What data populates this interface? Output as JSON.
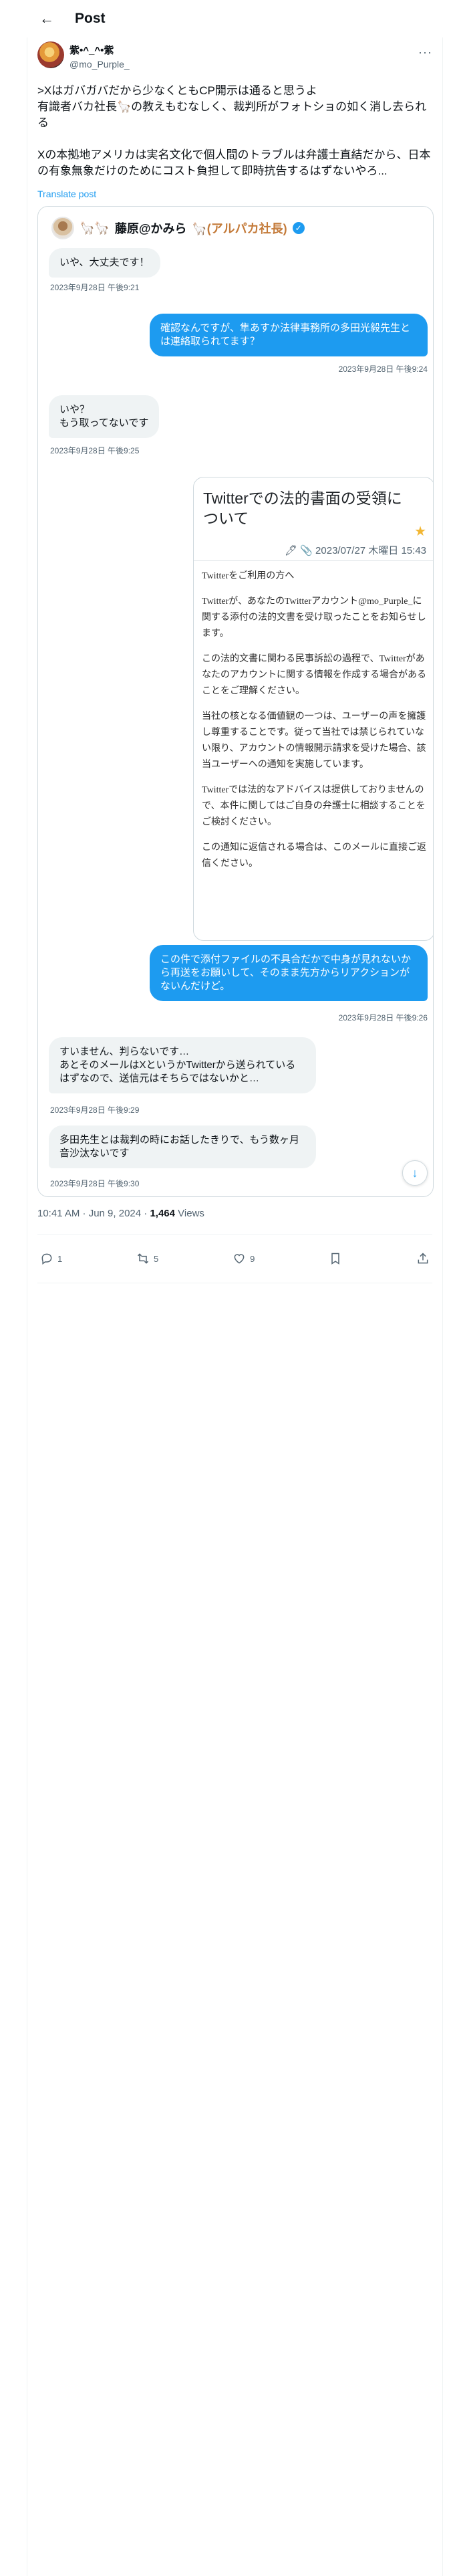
{
  "header": {
    "title": "Post"
  },
  "author": {
    "display_name": "紫•^_^•紫",
    "handle": "@mo_Purple_"
  },
  "tweet": {
    "text": ">Xはガバガバだから少なくともCP開示は通ると思うよ\n有識者バカ社長🦙の教えもむなしく、裁判所がフォトショの如く消し去られる\n\nXの本拠地アメリカは実名文化で個人間のトラブルは弁護士直結だから、日本の有象無象だけのためにコスト負担して即時抗告するはずないやろ...",
    "translate_label": "Translate post"
  },
  "screenshot": {
    "name_prefix": "🦙🦙",
    "name": "藤原@かみら",
    "name_suffix": "🦙(アルパカ社長)",
    "messages": [
      {
        "type": "recv",
        "text": "いや、大丈夫です！",
        "time": "2023年9月28日 午後9:21"
      },
      {
        "type": "sent",
        "text": "確認なんですが、隼あすか法律事務所の多田光毅先生とは連絡取られてます？",
        "time": "2023年9月28日 午後9:24"
      },
      {
        "type": "recv",
        "text": "いや？\nもう取ってないです",
        "time": "2023年9月28日 午後9:25"
      },
      {
        "type": "sent",
        "text": "この件で添付ファイルの不具合だかで中身が見れないから再送をお願いして、そのまま先方からリアクションがないんだけど。",
        "time": "2023年9月28日 午後9:26"
      },
      {
        "type": "recv",
        "text": "すいません、判らないです…\nあとそのメールはXというかTwitterから送られているはずなので、送信元はそちらではないかと…",
        "time": "2023年9月28日 午後9:29"
      },
      {
        "type": "recv",
        "text": "多田先生とは裁判の時にお話したきりで、もう数ヶ月音沙汰ないです",
        "time": "2023年9月28日 午後9:30"
      }
    ],
    "card": {
      "title": "Twitterでの法的書面の受領について",
      "meta": "🖊 📎 2023/07/27 木曜日 15:43",
      "paragraphs": [
        "Twitterをご利用の方へ",
        "Twitterが、あなたのTwitterアカウント@mo_Purple_に関する添付の法的文書を受け取ったことをお知らせします。",
        "この法的文書に関わる民事訴訟の過程で、Twitterがあなたのアカウントに関する情報を作成する場合があることをご理解ください。",
        "当社の核となる価値観の一つは、ユーザーの声を擁護し尊重することです。従って当社では禁じられていない限り、アカウントの情報開示請求を受けた場合、該当ユーザーへの通知を実施しています。",
        "Twitterでは法的なアドバイスは提供しておりませんので、本件に関してはご自身の弁護士に相談することをご検討ください。",
        "この通知に返信される場合は、このメールに直接ご返信ください。"
      ]
    }
  },
  "post_meta": {
    "time": "10:41 AM · Jun 9, 2024",
    "dot": " · ",
    "views_count": "1,464",
    "views_label": " Views"
  },
  "actions": {
    "replies": "1",
    "reposts": "5",
    "likes": "9"
  },
  "colors": {
    "accent": "#1d9bf0",
    "text": "#0f1419",
    "muted": "#536471"
  }
}
